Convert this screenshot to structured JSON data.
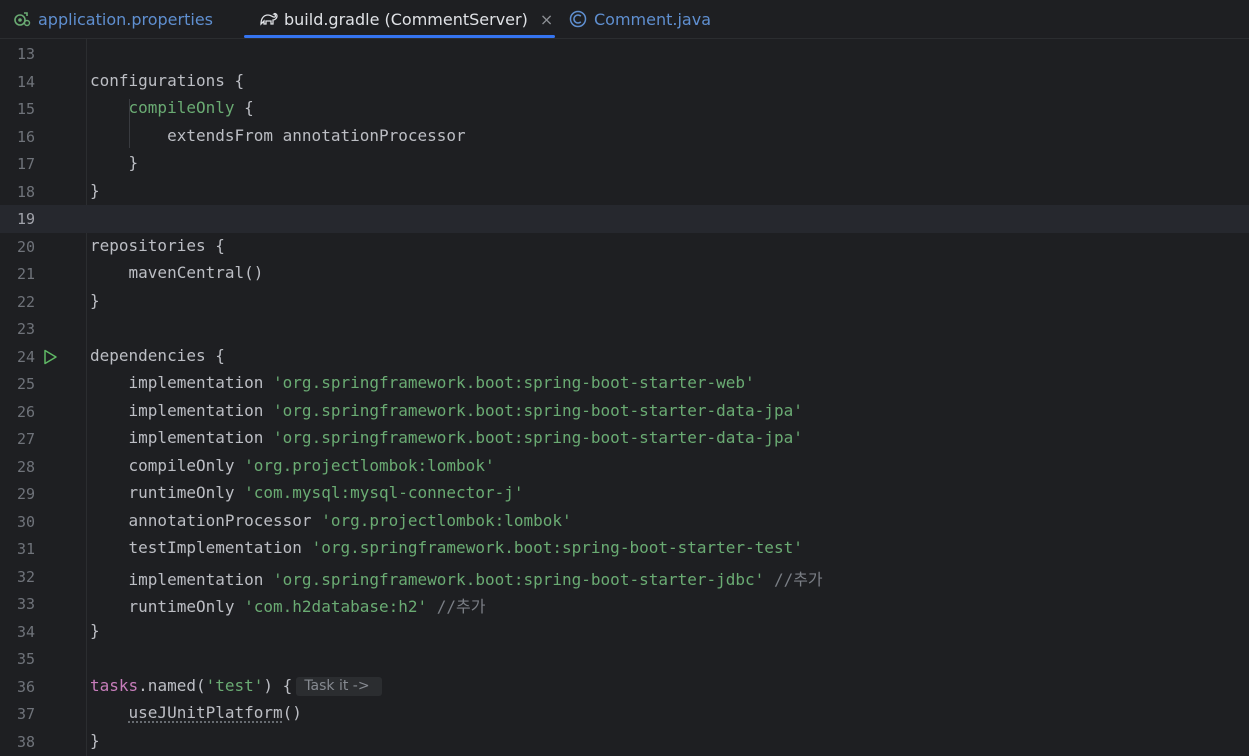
{
  "tabs": [
    {
      "label": "application.properties",
      "icon": "gradle-properties-icon",
      "active": false
    },
    {
      "label": "build.gradle (CommentServer)",
      "icon": "gradle-elephant-icon",
      "active": true,
      "close": "×"
    },
    {
      "label": "Comment.java",
      "icon": "class-c-icon",
      "active": false
    }
  ],
  "editor": {
    "current_line": 19,
    "lines": [
      {
        "n": "13",
        "segs": []
      },
      {
        "n": "14",
        "segs": [
          {
            "t": "configurations ",
            "c": "t-kw"
          },
          {
            "t": "{",
            "c": "t-kw"
          }
        ]
      },
      {
        "n": "15",
        "segs": [
          {
            "t": "    "
          },
          {
            "t": "compileOnly",
            "c": "t-green"
          },
          {
            "t": " {"
          }
        ]
      },
      {
        "n": "16",
        "segs": [
          {
            "t": "        extendsFrom annotationProcessor"
          }
        ]
      },
      {
        "n": "17",
        "segs": [
          {
            "t": "    }"
          }
        ]
      },
      {
        "n": "18",
        "segs": [
          {
            "t": "}"
          }
        ]
      },
      {
        "n": "19",
        "segs": []
      },
      {
        "n": "20",
        "segs": [
          {
            "t": "repositories {"
          }
        ]
      },
      {
        "n": "21",
        "segs": [
          {
            "t": "    mavenCentral()"
          }
        ]
      },
      {
        "n": "22",
        "segs": [
          {
            "t": "}"
          }
        ]
      },
      {
        "n": "23",
        "segs": []
      },
      {
        "n": "24",
        "segs": [
          {
            "t": "dependencies {"
          }
        ],
        "run": true
      },
      {
        "n": "25",
        "segs": [
          {
            "t": "    implementation "
          },
          {
            "t": "'org.springframework.boot:spring-boot-starter-web'",
            "c": "t-str"
          }
        ]
      },
      {
        "n": "26",
        "segs": [
          {
            "t": "    implementation "
          },
          {
            "t": "'org.springframework.boot:spring-boot-starter-data-jpa'",
            "c": "t-str"
          }
        ]
      },
      {
        "n": "27",
        "segs": [
          {
            "t": "    implementation "
          },
          {
            "t": "'org.springframework.boot:spring-boot-starter-data-jpa'",
            "c": "t-str"
          }
        ]
      },
      {
        "n": "28",
        "segs": [
          {
            "t": "    compileOnly "
          },
          {
            "t": "'org.projectlombok:lombok'",
            "c": "t-str"
          }
        ]
      },
      {
        "n": "29",
        "segs": [
          {
            "t": "    runtimeOnly "
          },
          {
            "t": "'com.mysql:mysql-connector-j'",
            "c": "t-str"
          }
        ]
      },
      {
        "n": "30",
        "segs": [
          {
            "t": "    annotationProcessor "
          },
          {
            "t": "'org.projectlombok:lombok'",
            "c": "t-str"
          }
        ]
      },
      {
        "n": "31",
        "segs": [
          {
            "t": "    testImplementation "
          },
          {
            "t": "'org.springframework.boot:spring-boot-starter-test'",
            "c": "t-str"
          }
        ]
      },
      {
        "n": "32",
        "segs": [
          {
            "t": "    implementation "
          },
          {
            "t": "'org.springframework.boot:spring-boot-starter-jdbc'",
            "c": "t-str"
          },
          {
            "t": " //추가",
            "c": "t-cmt"
          }
        ]
      },
      {
        "n": "33",
        "segs": [
          {
            "t": "    runtimeOnly "
          },
          {
            "t": "'com.h2database:h2'",
            "c": "t-str"
          },
          {
            "t": " //추가",
            "c": "t-cmt"
          }
        ]
      },
      {
        "n": "34",
        "segs": [
          {
            "t": "}"
          }
        ]
      },
      {
        "n": "35",
        "segs": []
      },
      {
        "n": "36",
        "segs": [
          {
            "t": "tasks",
            "c": "t-purple"
          },
          {
            "t": ".named("
          },
          {
            "t": "'test'",
            "c": "t-str"
          },
          {
            "t": ") {"
          }
        ],
        "inlay": "Task it ->"
      },
      {
        "n": "37",
        "segs": [
          {
            "t": "    "
          },
          {
            "t": "useJUnitPlatform",
            "c": "t-under"
          },
          {
            "t": "()"
          }
        ]
      },
      {
        "n": "38",
        "segs": [
          {
            "t": "}"
          }
        ]
      }
    ]
  },
  "colors": {
    "background": "#1e1f22",
    "accent_tab": "#3574f0",
    "string": "#6aab73",
    "comment": "#7a7e85",
    "keyword_purple": "#c77dbb"
  }
}
